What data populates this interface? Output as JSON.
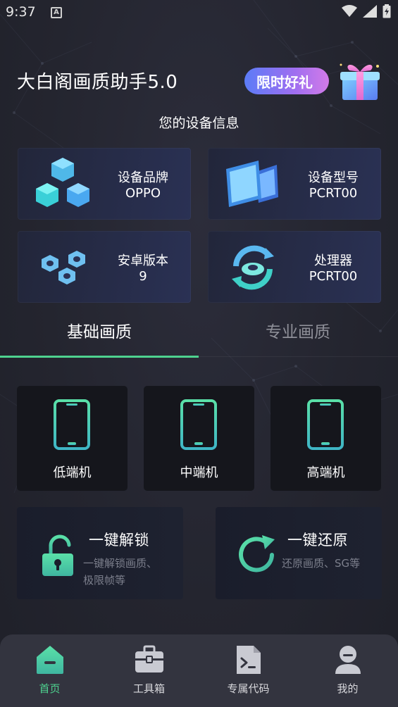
{
  "status_bar": {
    "time": "9:37",
    "notification_icon": "A"
  },
  "header": {
    "title": "大白阁画质助手5.0",
    "promo_label": "限时好礼"
  },
  "device_info": {
    "section_title": "您的设备信息",
    "cards": [
      {
        "label": "设备品牌",
        "value": "OPPO",
        "icon": "cubes-icon"
      },
      {
        "label": "设备型号",
        "value": "PCRT00",
        "icon": "devices-icon"
      },
      {
        "label": "安卓版本",
        "value": "9",
        "icon": "hex-nuts-icon"
      },
      {
        "label": "处理器",
        "value": "PCRT00",
        "icon": "processor-icon"
      }
    ]
  },
  "tabs": {
    "items": [
      "基础画质",
      "专业画质"
    ],
    "active_index": 0
  },
  "tiers": [
    "低端机",
    "中端机",
    "高端机"
  ],
  "actions": [
    {
      "title": "一键解锁",
      "desc_line1": "一键解锁画质、",
      "desc_line2": "极限帧等",
      "icon": "unlock-icon"
    },
    {
      "title": "一键还原",
      "desc_line1": "还原画质、SG等",
      "icon": "restore-icon"
    }
  ],
  "bottom_nav": {
    "items": [
      {
        "label": "首页",
        "icon": "home-icon"
      },
      {
        "label": "工具箱",
        "icon": "toolbox-icon"
      },
      {
        "label": "专属代码",
        "icon": "code-file-icon"
      },
      {
        "label": "我的",
        "icon": "profile-icon"
      }
    ],
    "active_index": 0
  },
  "colors": {
    "accent": "#4ed28f",
    "background": "#24252f",
    "card": "#2a3154",
    "tier_card": "#15161c",
    "nav_bar": "#33343f"
  }
}
